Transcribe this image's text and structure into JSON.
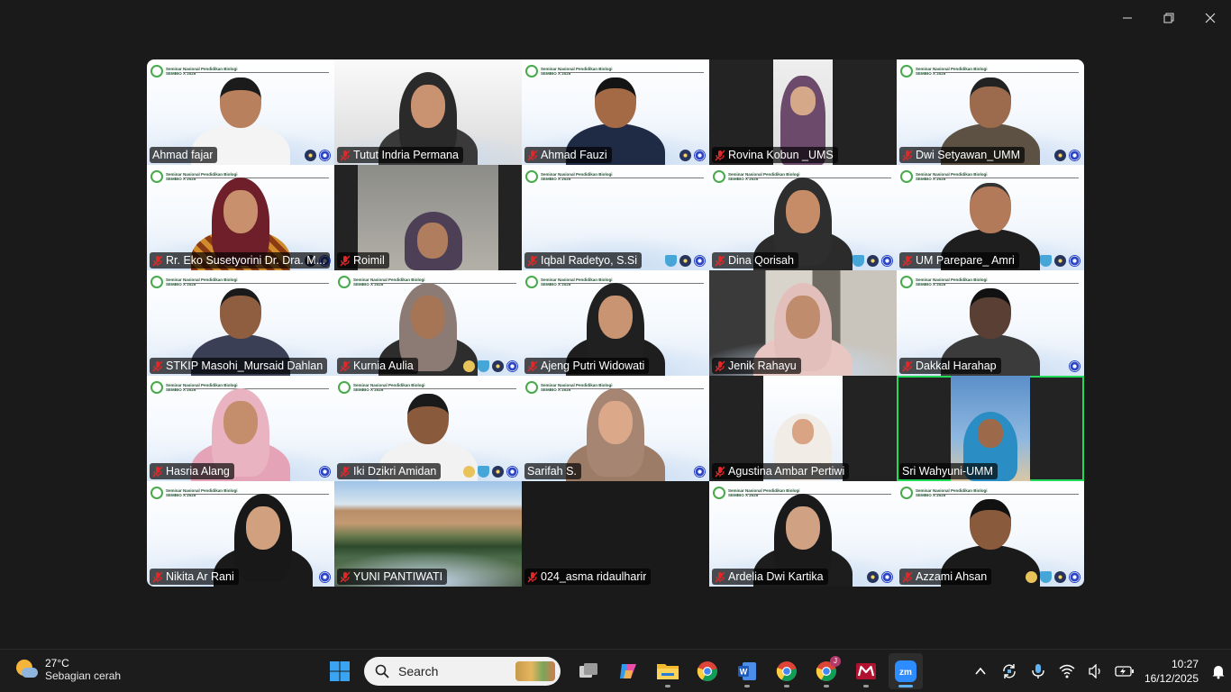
{
  "window": {
    "controls": [
      "minimize",
      "restore",
      "close"
    ]
  },
  "banner": {
    "line1": "Seminar Nasional Pendidikan Biologi",
    "line2": "SEMBIO X 2025"
  },
  "participants": [
    {
      "name": "Ahmad fajar",
      "muted": false
    },
    {
      "name": "Tutut Indria Permana",
      "muted": true
    },
    {
      "name": "Ahmad Fauzi",
      "muted": true
    },
    {
      "name": "Rovina Kobun _UMS",
      "muted": true
    },
    {
      "name": "Dwi Setyawan_UMM",
      "muted": true
    },
    {
      "name": "Rr. Eko Susetyorini Dr. Dra. M...",
      "muted": true
    },
    {
      "name": "Roimil",
      "muted": true
    },
    {
      "name": "Iqbal Radetyo, S.Si",
      "muted": true
    },
    {
      "name": "Dina Qorisah",
      "muted": true
    },
    {
      "name": "UM Parepare_ Amri",
      "muted": true
    },
    {
      "name": "STKIP Masohi_Mursaid Dahlan",
      "muted": true
    },
    {
      "name": "Kurnia Aulia",
      "muted": true
    },
    {
      "name": "Ajeng Putri Widowati",
      "muted": true
    },
    {
      "name": "Jenik Rahayu",
      "muted": true
    },
    {
      "name": "Dakkal Harahap",
      "muted": true
    },
    {
      "name": "Hasria Alang",
      "muted": true
    },
    {
      "name": "Iki Dzikri Amidan",
      "muted": true
    },
    {
      "name": "Sarifah S.",
      "muted": false
    },
    {
      "name": "Agustina Ambar Pertiwi",
      "muted": true
    },
    {
      "name": "Sri Wahyuni-UMM",
      "muted": false,
      "speaking": true
    },
    {
      "name": "Nikita Ar Rani",
      "muted": true
    },
    {
      "name": "YUNI PANTIWATI",
      "muted": true
    },
    {
      "name": "024_asma ridaulharir",
      "muted": true
    },
    {
      "name": "Ardelia Dwi Kartika",
      "muted": true
    },
    {
      "name": "Azzami Ahsan",
      "muted": true
    }
  ],
  "taskbar": {
    "weather": {
      "temp": "27°C",
      "condition": "Sebagian cerah",
      "icon": "partly-sunny-icon"
    },
    "search_label": "Search",
    "apps": [
      "windows-start",
      "search",
      "task-view",
      "copilot",
      "file-explorer",
      "chrome",
      "word",
      "chrome-profile-1",
      "chrome-profile-2",
      "mendeley",
      "zoom"
    ],
    "chrome_badge": "J",
    "zoom_label": "zm",
    "word_label": "W",
    "clock": {
      "time": "10:27",
      "date": "16/12/2025"
    }
  }
}
